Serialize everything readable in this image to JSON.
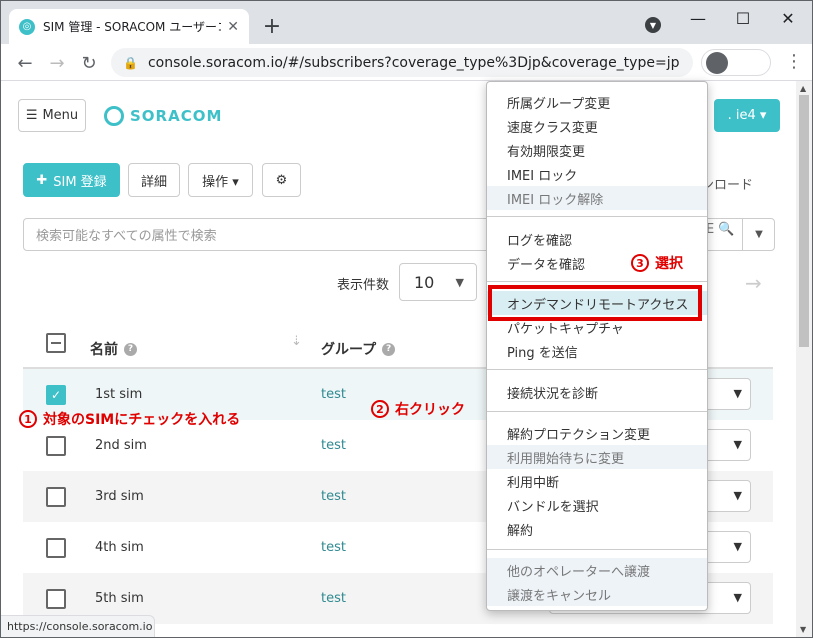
{
  "browser": {
    "tab_title": "SIM 管理 - SORACOM ユーザーコンソ",
    "tab_close": "✕",
    "new_tab": "+",
    "url": "console.soracom.io/#/subscribers?coverage_type%3Djp&coverage_type=jp",
    "status_url": "https://console.soracom.io",
    "win_minimize": "—",
    "win_maximize": "☐",
    "win_close": "✕"
  },
  "header": {
    "menu_label": "Menu",
    "logo_text": "SORACOM",
    "operator_label": ". ie4 ▾"
  },
  "toolbar": {
    "register_label": "SIM 登録",
    "detail_label": "詳細",
    "operation_label": "操作 ▾",
    "download_label": "ンロード"
  },
  "search": {
    "placeholder": "検索可能なすべての属性で検索",
    "tail": "E"
  },
  "paging": {
    "per_page_label": "表示件数",
    "per_page_value": "10"
  },
  "table": {
    "columns": [
      "名前",
      "グループ"
    ],
    "rows": [
      {
        "name": "1st sim",
        "group": "test",
        "checked": true
      },
      {
        "name": "2nd sim",
        "group": "test",
        "checked": false
      },
      {
        "name": "3rd sim",
        "group": "test",
        "checked": false
      },
      {
        "name": "4th sim",
        "group": "test",
        "checked": false
      },
      {
        "name": "5th sim",
        "group": "test",
        "checked": false
      }
    ]
  },
  "context_menu": {
    "group1": [
      "所属グループ変更",
      "速度クラス変更",
      "有効期限変更",
      "IMEI ロック",
      "IMEI ロック解除"
    ],
    "group2": [
      "ログを確認",
      "データを確認"
    ],
    "group3": [
      "オンデマンドリモートアクセス",
      "パケットキャプチャ",
      "Ping を送信"
    ],
    "group4": [
      "接続状況を診断"
    ],
    "group5": [
      "解約プロテクション変更",
      "利用開始待ちに変更",
      "利用中断",
      "バンドルを選択",
      "解約"
    ],
    "group6": [
      "他のオペレーターへ譲渡",
      "譲渡をキャンセル"
    ]
  },
  "annotations": {
    "step1_num": "1",
    "step1_text": "対象のSIMにチェックを入れる",
    "step2_num": "2",
    "step2_text": "右クリック",
    "step3_num": "3",
    "step3_text": "選択"
  },
  "colors": {
    "brand": "#3ec0c9",
    "annotation": "#e00000"
  }
}
